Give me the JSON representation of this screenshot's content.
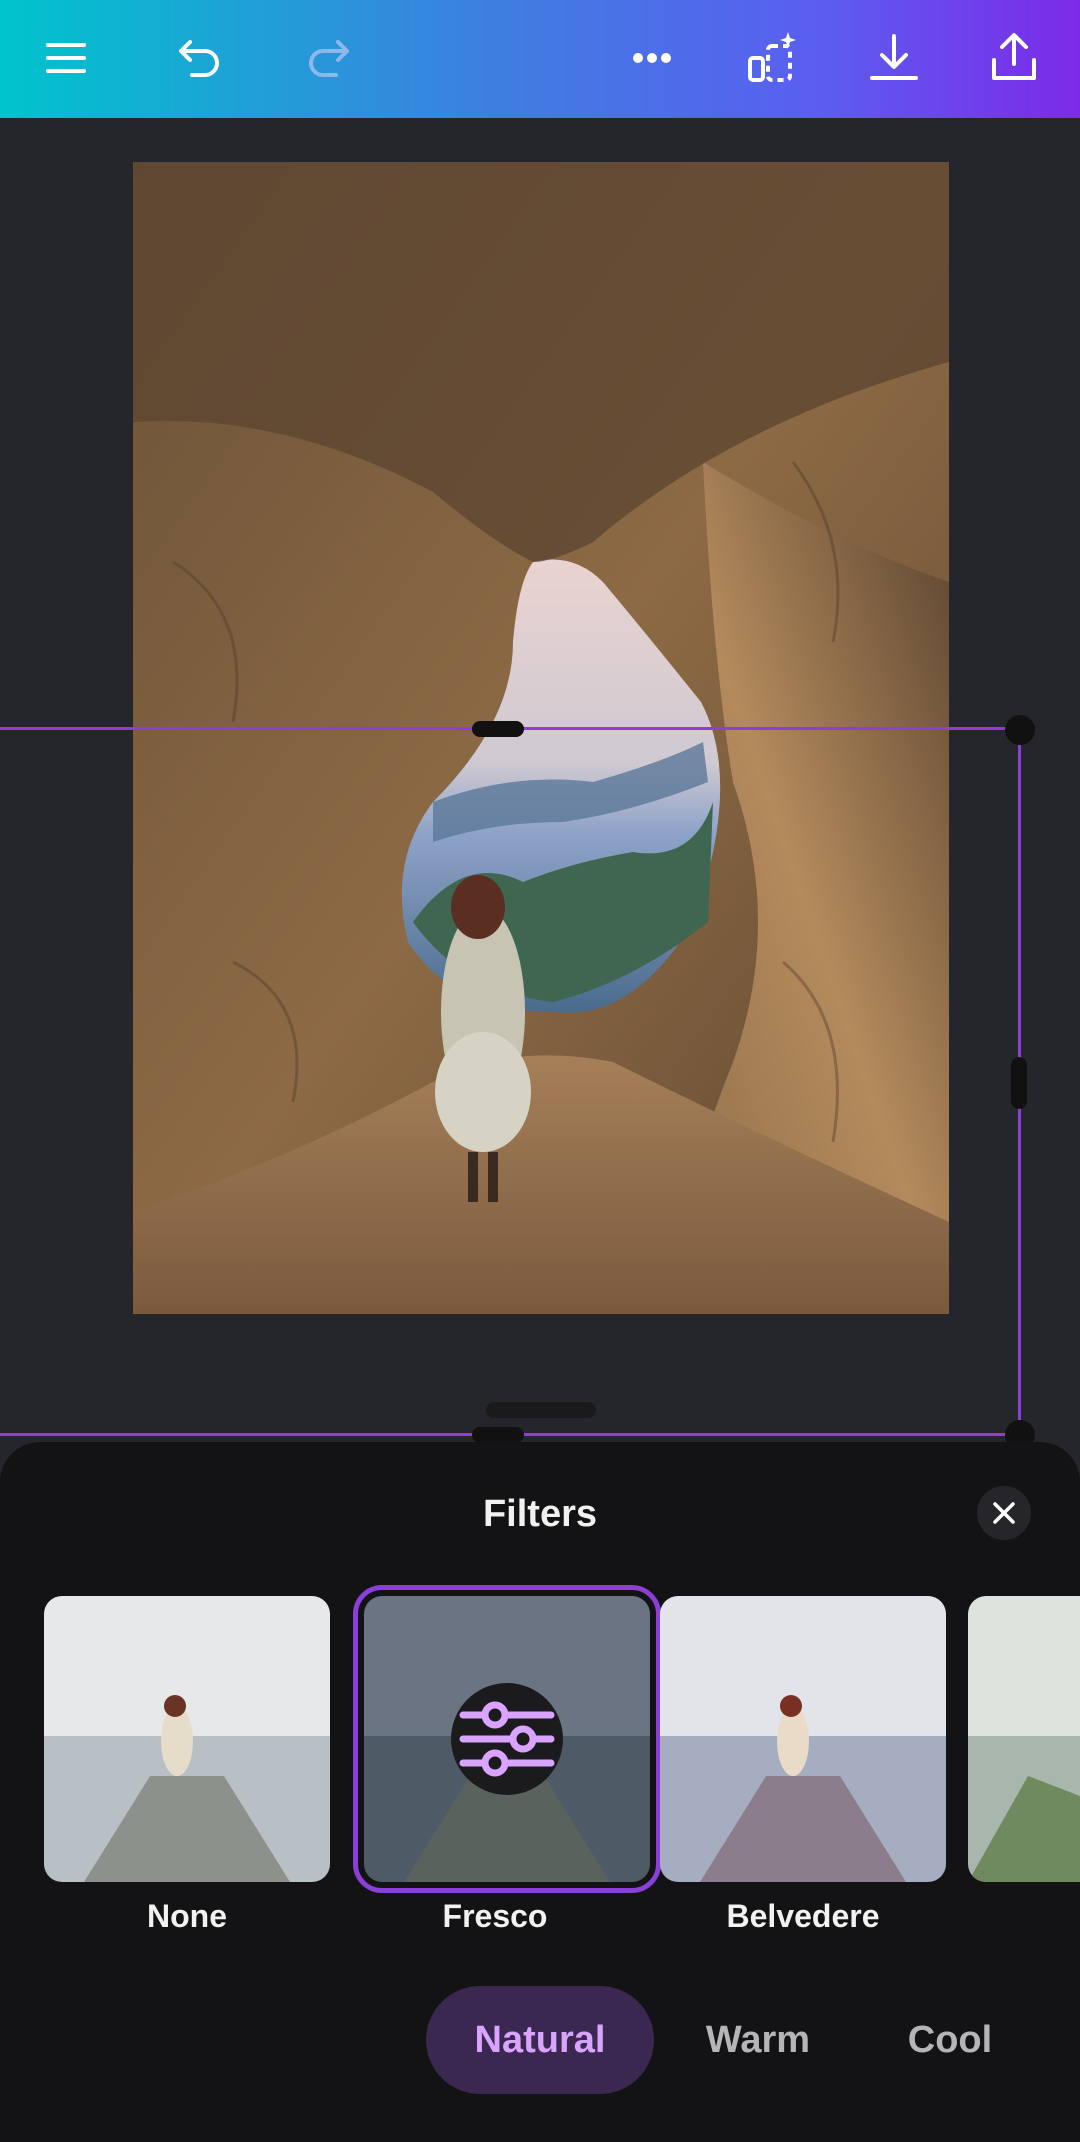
{
  "sheet": {
    "title": "Filters"
  },
  "filters": [
    {
      "label": "None"
    },
    {
      "label": "Fresco",
      "selected": true
    },
    {
      "label": "Belvedere"
    }
  ],
  "categories": [
    {
      "label": "Natural",
      "active": true
    },
    {
      "label": "Warm",
      "active": false
    },
    {
      "label": "Cool",
      "active": false
    }
  ],
  "colors": {
    "accent": "#8b3fd9",
    "topbar_start": "#00c4cc",
    "topbar_end": "#7d2ae8",
    "sheet_bg": "#131315",
    "canvas_bg": "#25262b",
    "category_active_text": "#d9a4ff"
  },
  "icons": {
    "menu": "hamburger-icon",
    "undo": "undo-icon",
    "redo": "redo-icon",
    "more": "more-horizontal-icon",
    "magic": "magic-resize-icon",
    "download": "download-icon",
    "share": "share-icon",
    "close": "close-icon",
    "adjust": "sliders-icon"
  }
}
